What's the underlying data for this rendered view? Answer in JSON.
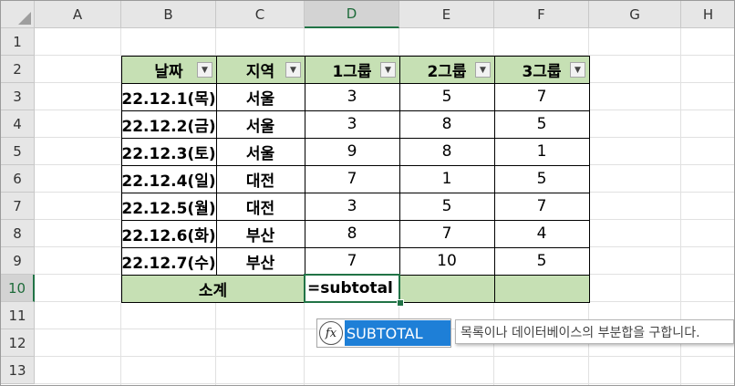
{
  "columns": [
    "A",
    "B",
    "C",
    "D",
    "E",
    "F",
    "G",
    "H"
  ],
  "rows": [
    "1",
    "2",
    "3",
    "4",
    "5",
    "6",
    "7",
    "8",
    "9",
    "10",
    "11",
    "12",
    "13"
  ],
  "selected_column": "D",
  "selected_row": "10",
  "table": {
    "headers": [
      "날짜",
      "지역",
      "1그룹",
      "2그룹",
      "3그룹"
    ],
    "filter_icon": "dropdown-arrow-icon",
    "data": [
      [
        "22.12.1(목)",
        "서울",
        "3",
        "5",
        "7"
      ],
      [
        "22.12.2(금)",
        "서울",
        "3",
        "8",
        "5"
      ],
      [
        "22.12.3(토)",
        "서울",
        "9",
        "8",
        "1"
      ],
      [
        "22.12.4(일)",
        "대전",
        "7",
        "1",
        "5"
      ],
      [
        "22.12.5(월)",
        "대전",
        "3",
        "5",
        "7"
      ],
      [
        "22.12.6(화)",
        "부산",
        "8",
        "7",
        "4"
      ],
      [
        "22.12.7(수)",
        "부산",
        "7",
        "10",
        "5"
      ]
    ],
    "total_label": "소계",
    "active_cell_value": "=subtotal"
  },
  "autocomplete": {
    "icon": "function-fx-icon",
    "icon_glyph": "fx",
    "item": "SUBTOTAL",
    "tooltip": "목록이나 데이터베이스의 부분합을 구합니다."
  },
  "colors": {
    "header_fill": "#c6e0b4",
    "accent": "#217346",
    "autocomplete_highlight": "#1e7fd7"
  }
}
